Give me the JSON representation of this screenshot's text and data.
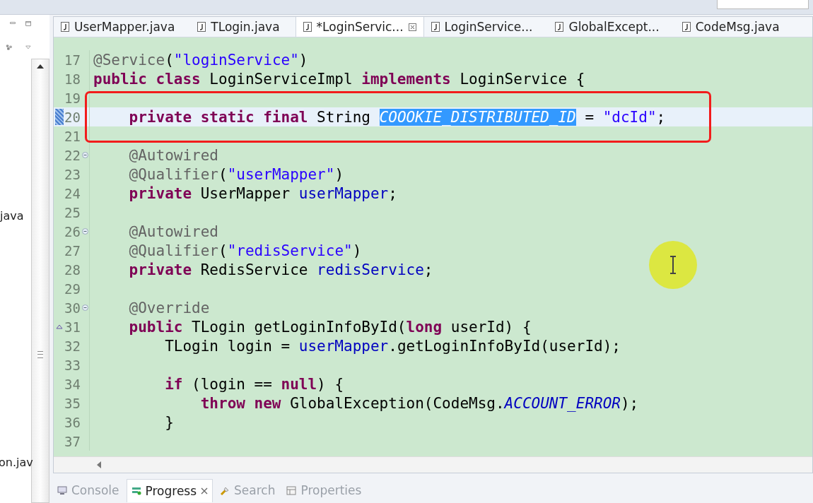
{
  "sidebar": {
    "items": [
      {
        "label": "java"
      },
      {
        "label": "on.jav"
      }
    ]
  },
  "editor_tabs": [
    {
      "label": "UserMapper.java",
      "selected": false
    },
    {
      "label": "TLogin.java",
      "selected": false
    },
    {
      "label": "*LoginServic...",
      "selected": true
    },
    {
      "label": "LoginService...",
      "selected": false
    },
    {
      "label": "GlobalExcept...",
      "selected": false
    },
    {
      "label": "CodeMsg.java",
      "selected": false
    }
  ],
  "code_lines": [
    {
      "number": "17",
      "fold": false,
      "override": false,
      "current": false,
      "tokens": [
        {
          "kind": "annotation",
          "text": "@Service"
        },
        {
          "kind": "plain",
          "text": "("
        },
        {
          "kind": "string",
          "text": "\"loginService\""
        },
        {
          "kind": "plain",
          "text": ")"
        }
      ]
    },
    {
      "number": "18",
      "fold": false,
      "override": false,
      "current": false,
      "tokens": [
        {
          "kind": "keyword",
          "text": "public class"
        },
        {
          "kind": "plain",
          "text": " LoginServiceImpl "
        },
        {
          "kind": "keyword",
          "text": "implements"
        },
        {
          "kind": "plain",
          "text": " LoginService {"
        }
      ]
    },
    {
      "number": "19",
      "fold": false,
      "override": false,
      "current": false
    },
    {
      "number": "20",
      "fold": false,
      "override": false,
      "current": true,
      "tokens": [
        {
          "kind": "keyword",
          "text": "    private static final"
        },
        {
          "kind": "plain",
          "text": " String "
        },
        {
          "kind": "selected",
          "text": "COOOKIE_DISTRIBUTED_ID"
        },
        {
          "kind": "plain",
          "text": " = "
        },
        {
          "kind": "string",
          "text": "\"dcId\""
        },
        {
          "kind": "plain",
          "text": ";"
        }
      ]
    },
    {
      "number": "21",
      "fold": false,
      "override": false,
      "current": false
    },
    {
      "number": "22",
      "fold": true,
      "override": false,
      "current": false,
      "tokens": [
        {
          "kind": "annotation",
          "text": "    @Autowired"
        }
      ]
    },
    {
      "number": "23",
      "fold": false,
      "override": false,
      "current": false,
      "tokens": [
        {
          "kind": "annotation",
          "text": "    @Qualifier"
        },
        {
          "kind": "plain",
          "text": "("
        },
        {
          "kind": "string",
          "text": "\"userMapper\""
        },
        {
          "kind": "plain",
          "text": ")"
        }
      ]
    },
    {
      "number": "24",
      "fold": false,
      "override": false,
      "current": false,
      "tokens": [
        {
          "kind": "keyword",
          "text": "    private"
        },
        {
          "kind": "plain",
          "text": " UserMapper "
        },
        {
          "kind": "field",
          "text": "userMapper"
        },
        {
          "kind": "plain",
          "text": ";"
        }
      ]
    },
    {
      "number": "25",
      "fold": false,
      "override": false,
      "current": false
    },
    {
      "number": "26",
      "fold": true,
      "override": false,
      "current": false,
      "tokens": [
        {
          "kind": "annotation",
          "text": "    @Autowired"
        }
      ]
    },
    {
      "number": "27",
      "fold": false,
      "override": false,
      "current": false,
      "tokens": [
        {
          "kind": "annotation",
          "text": "    @Qualifier"
        },
        {
          "kind": "plain",
          "text": "("
        },
        {
          "kind": "string",
          "text": "\"redisService\""
        },
        {
          "kind": "plain",
          "text": ")"
        }
      ]
    },
    {
      "number": "28",
      "fold": false,
      "override": false,
      "current": false,
      "tokens": [
        {
          "kind": "keyword",
          "text": "    private"
        },
        {
          "kind": "plain",
          "text": " RedisService "
        },
        {
          "kind": "field",
          "text": "redisService"
        },
        {
          "kind": "plain",
          "text": ";"
        }
      ]
    },
    {
      "number": "29",
      "fold": false,
      "override": false,
      "current": false
    },
    {
      "number": "30",
      "fold": true,
      "override": false,
      "current": false,
      "tokens": [
        {
          "kind": "annotation",
          "text": "    @Override"
        }
      ]
    },
    {
      "number": "31",
      "fold": false,
      "override": true,
      "current": false,
      "tokens": [
        {
          "kind": "keyword",
          "text": "    public"
        },
        {
          "kind": "plain",
          "text": " TLogin getLoginInfoById("
        },
        {
          "kind": "keyword",
          "text": "long"
        },
        {
          "kind": "plain",
          "text": " userId) {"
        }
      ]
    },
    {
      "number": "32",
      "fold": false,
      "override": false,
      "current": false,
      "tokens": [
        {
          "kind": "plain",
          "text": "        TLogin login = "
        },
        {
          "kind": "field",
          "text": "userMapper"
        },
        {
          "kind": "plain",
          "text": ".getLoginInfoById(userId);"
        }
      ]
    },
    {
      "number": "33",
      "fold": false,
      "override": false,
      "current": false
    },
    {
      "number": "34",
      "fold": false,
      "override": false,
      "current": false,
      "tokens": [
        {
          "kind": "keyword",
          "text": "        if"
        },
        {
          "kind": "plain",
          "text": " (login == "
        },
        {
          "kind": "keyword",
          "text": "null"
        },
        {
          "kind": "plain",
          "text": ") {"
        }
      ]
    },
    {
      "number": "35",
      "fold": false,
      "override": false,
      "current": false,
      "tokens": [
        {
          "kind": "keyword",
          "text": "            throw new"
        },
        {
          "kind": "plain",
          "text": " GlobalException(CodeMsg."
        },
        {
          "kind": "static",
          "text": "ACCOUNT_ERROR"
        },
        {
          "kind": "plain",
          "text": ");"
        }
      ]
    },
    {
      "number": "36",
      "fold": false,
      "override": false,
      "current": false,
      "tokens": [
        {
          "kind": "plain",
          "text": "        }"
        }
      ]
    },
    {
      "number": "37",
      "fold": false,
      "override": false,
      "current": false
    }
  ],
  "bottom_tabs": [
    {
      "label": "Console",
      "selected": false,
      "kind": "console"
    },
    {
      "label": "Progress",
      "selected": true,
      "kind": "progress"
    },
    {
      "label": "Search",
      "selected": false,
      "kind": "search"
    },
    {
      "label": "Properties",
      "selected": false,
      "kind": "properties"
    }
  ]
}
